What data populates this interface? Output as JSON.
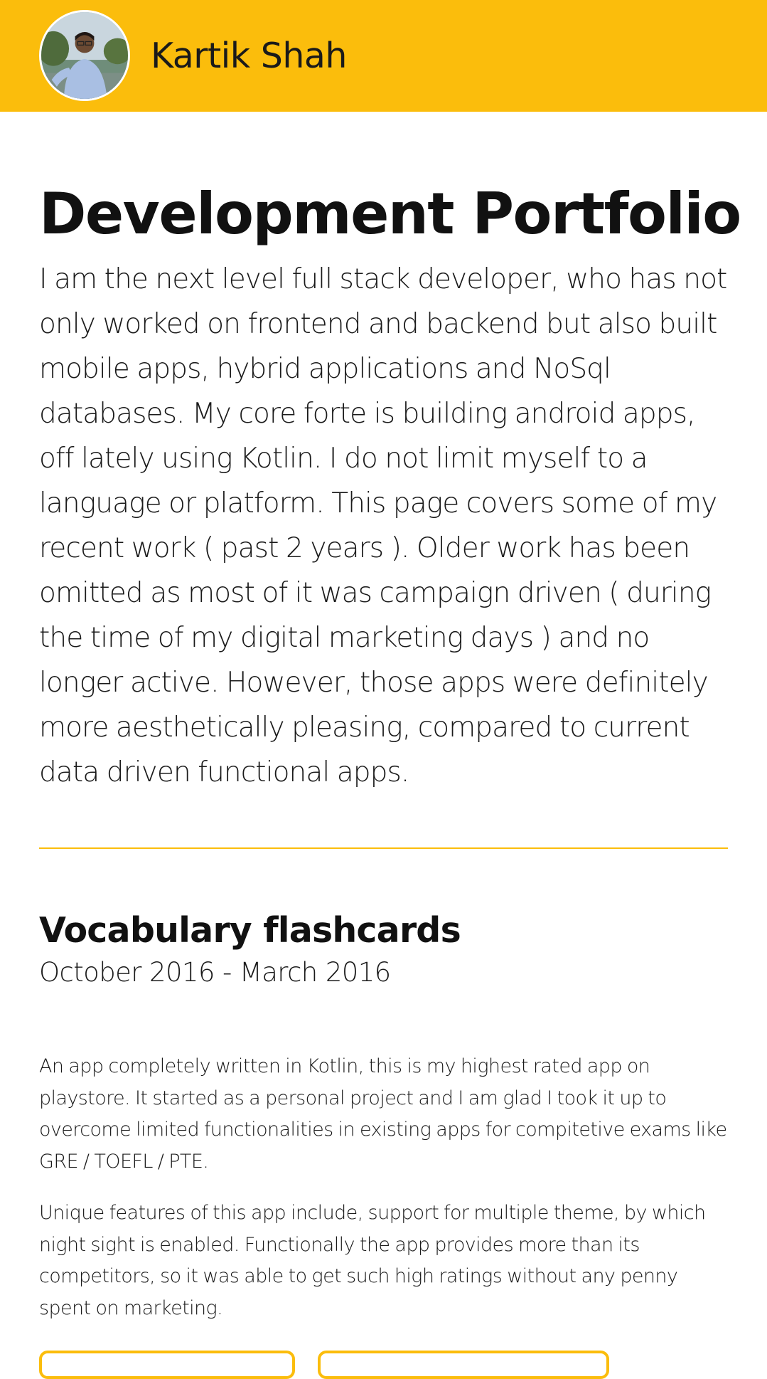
{
  "header": {
    "avatar_icon": "profile-photo",
    "name": "Kartik Shah",
    "background_color": "#fbbd0c"
  },
  "main": {
    "title": "Development Portfolio",
    "intro": "I am the next level full stack developer, who has not only worked on frontend and backend but also built mobile apps, hybrid applications and NoSql databases. My core forte is building android apps, off lately using Kotlin. I do not limit myself to a language or platform. This page covers some of my recent work ( past 2 years ). Older work has been omitted as most of it was campaign driven ( during the time of my digital marketing days ) and no longer active. However, those apps were definitely more aesthetically pleasing, compared to current data driven functional apps.",
    "divider_color": "#fbbd0c"
  },
  "projects": [
    {
      "title": "Vocabulary flashcards",
      "dates": "October 2016 - March 2016",
      "paragraphs": [
        "An app completely written in Kotlin, this is my highest rated app on playstore. It started as a personal project and I am glad I took it up to overcome limited functionalities in existing apps for compitetive exams like GRE / TOEFL / PTE.",
        "Unique features of this app include, support for multiple theme, by which night sight is enabled. Functionally the app provides more than its competitors, so it was able to get such high ratings without any penny spent on marketing."
      ]
    }
  ]
}
